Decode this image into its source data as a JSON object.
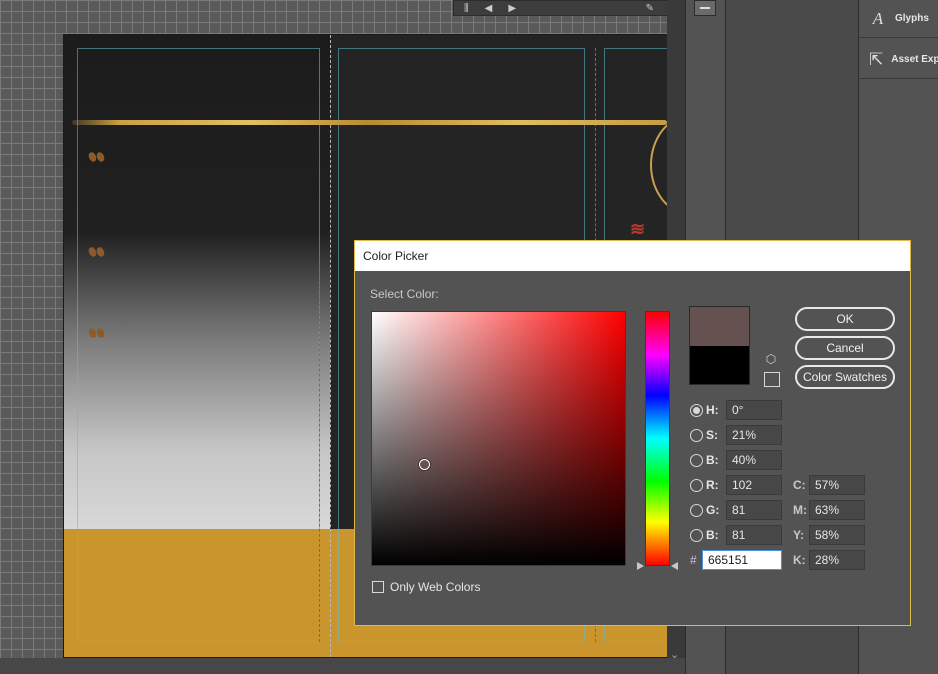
{
  "colors": {
    "accent_border": "#e0b84a",
    "current_color": "#665151",
    "original_color": "#000000",
    "document_gold": "#c9952c"
  },
  "side_panels": {
    "items": [
      {
        "label": "Glyphs",
        "icon": "glyphs-icon"
      },
      {
        "label": "Asset Exp",
        "icon": "asset-export-icon"
      }
    ]
  },
  "dialog": {
    "title": "Color Picker",
    "select_color_label": "Select Color:",
    "buttons": {
      "ok": "OK",
      "cancel": "Cancel",
      "swatches": "Color Swatches"
    },
    "hsb": [
      {
        "label": "H:",
        "value": "0°",
        "selected": true
      },
      {
        "label": "S:",
        "value": "21%",
        "selected": false
      },
      {
        "label": "B:",
        "value": "40%",
        "selected": false
      }
    ],
    "rgb": [
      {
        "label": "R:",
        "value": "102"
      },
      {
        "label": "G:",
        "value": "81"
      },
      {
        "label": "B:",
        "value": "81"
      }
    ],
    "cmyk": [
      {
        "label": "C:",
        "value": "57%"
      },
      {
        "label": "M:",
        "value": "63%"
      },
      {
        "label": "Y:",
        "value": "58%"
      },
      {
        "label": "K:",
        "value": "28%"
      }
    ],
    "hex_label": "#",
    "hex_value": "665151",
    "web_colors_label": "Only Web Colors",
    "web_colors_checked": false
  }
}
